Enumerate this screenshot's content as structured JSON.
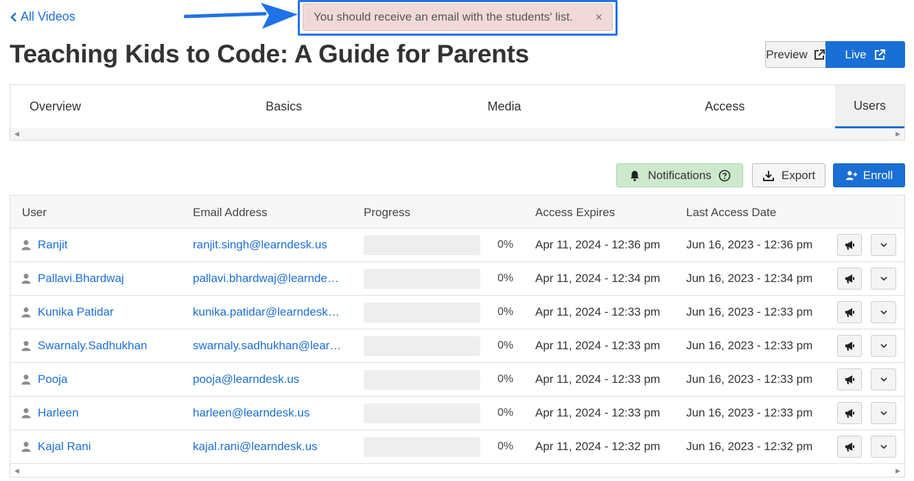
{
  "nav": {
    "back_label": "All Videos"
  },
  "toast": {
    "message": "You should receive an email with the students' list.",
    "close": "×"
  },
  "page": {
    "title": "Teaching Kids to Code: A Guide for Parents"
  },
  "header_buttons": {
    "preview": "Preview",
    "live": "Live"
  },
  "tabs": [
    {
      "label": "Overview"
    },
    {
      "label": "Basics"
    },
    {
      "label": "Media"
    },
    {
      "label": "Access"
    },
    {
      "label": "Users",
      "active": true
    }
  ],
  "toolbar": {
    "notifications": "Notifications",
    "export": "Export",
    "enroll": "Enroll"
  },
  "table": {
    "headers": [
      "User",
      "Email Address",
      "Progress",
      "Access Expires",
      "Last Access Date"
    ],
    "rows": [
      {
        "user": "Ranjit",
        "email": "ranjit.singh@learndesk.us",
        "progress": "0%",
        "expires": "Apr 11, 2024 - 12:36 pm",
        "last": "Jun 16, 2023 - 12:36 pm"
      },
      {
        "user": "Pallavi.Bhardwaj",
        "email": "pallavi.bhardwaj@learndesk.us",
        "progress": "0%",
        "expires": "Apr 11, 2024 - 12:34 pm",
        "last": "Jun 16, 2023 - 12:34 pm"
      },
      {
        "user": "Kunika Patidar",
        "email": "kunika.patidar@learndesk.us",
        "progress": "0%",
        "expires": "Apr 11, 2024 - 12:33 pm",
        "last": "Jun 16, 2023 - 12:33 pm"
      },
      {
        "user": "Swarnaly.Sadhukhan",
        "email": "swarnaly.sadhukhan@learndesk.us",
        "progress": "0%",
        "expires": "Apr 11, 2024 - 12:33 pm",
        "last": "Jun 16, 2023 - 12:33 pm"
      },
      {
        "user": "Pooja",
        "email": "pooja@learndesk.us",
        "progress": "0%",
        "expires": "Apr 11, 2024 - 12:33 pm",
        "last": "Jun 16, 2023 - 12:33 pm"
      },
      {
        "user": "Harleen",
        "email": "harleen@learndesk.us",
        "progress": "0%",
        "expires": "Apr 11, 2024 - 12:33 pm",
        "last": "Jun 16, 2023 - 12:33 pm"
      },
      {
        "user": "Kajal Rani",
        "email": "kajal.rani@learndesk.us",
        "progress": "0%",
        "expires": "Apr 11, 2024 - 12:32 pm",
        "last": "Jun 16, 2023 - 12:32 pm"
      }
    ]
  },
  "colors": {
    "link": "#1a6fd4",
    "toast_bg": "#f2d9d9",
    "notif_bg": "#cce9cc",
    "primary": "#1a6fd4"
  }
}
